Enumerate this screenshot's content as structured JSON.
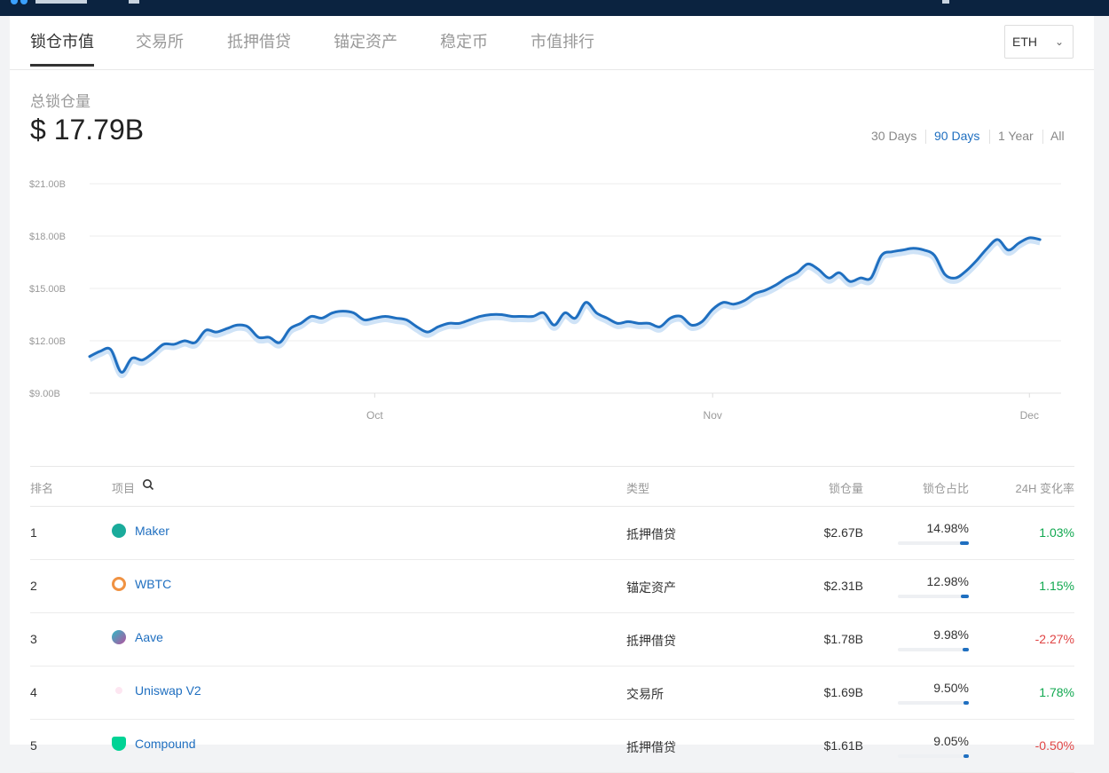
{
  "tabs": [
    {
      "label": "锁仓市值",
      "active": true
    },
    {
      "label": "交易所",
      "active": false
    },
    {
      "label": "抵押借贷",
      "active": false
    },
    {
      "label": "锚定资产",
      "active": false
    },
    {
      "label": "稳定币",
      "active": false
    },
    {
      "label": "市值排行",
      "active": false
    }
  ],
  "currency_select": {
    "value": "ETH"
  },
  "summary": {
    "label": "总锁仓量",
    "value": "$ 17.79B"
  },
  "ranges": [
    {
      "label": "30 Days",
      "active": false
    },
    {
      "label": "90 Days",
      "active": true
    },
    {
      "label": "1 Year",
      "active": false
    },
    {
      "label": "All",
      "active": false
    }
  ],
  "chart_data": {
    "type": "line",
    "yticks": [
      "$21.00B",
      "$18.00B",
      "$15.00B",
      "$12.00B",
      "$9.00B"
    ],
    "ylim": [
      9,
      21
    ],
    "xticks": [
      {
        "label": "Oct",
        "day": 27
      },
      {
        "label": "Nov",
        "day": 59
      },
      {
        "label": "Dec",
        "day": 89
      }
    ],
    "xlim": [
      0,
      92
    ],
    "grid": true,
    "color": "#1f6fc0",
    "series": [
      {
        "values": [
          11.1,
          11.4,
          11.5,
          10.2,
          11.0,
          10.9,
          11.3,
          11.8,
          11.8,
          12.0,
          11.9,
          12.6,
          12.5,
          12.7,
          12.9,
          12.8,
          12.2,
          12.2,
          11.9,
          12.7,
          13.0,
          13.4,
          13.3,
          13.6,
          13.7,
          13.6,
          13.2,
          13.3,
          13.4,
          13.3,
          13.2,
          12.8,
          12.5,
          12.8,
          13.0,
          13.0,
          13.2,
          13.4,
          13.5,
          13.5,
          13.4,
          13.4,
          13.4,
          13.6,
          12.9,
          13.6,
          13.3,
          14.2,
          13.6,
          13.3,
          13.0,
          13.1,
          13.0,
          13.0,
          12.8,
          13.3,
          13.4,
          12.9,
          13.1,
          13.8,
          14.2,
          14.1,
          14.3,
          14.7,
          14.9,
          15.2,
          15.6,
          15.9,
          16.4,
          16.1,
          15.6,
          15.9,
          15.4,
          15.6,
          15.6,
          16.9,
          17.1,
          17.2,
          17.3,
          17.2,
          16.9,
          15.8,
          15.6,
          16.0,
          16.6,
          17.3,
          17.8,
          17.2,
          17.6,
          17.9,
          17.8
        ]
      }
    ]
  },
  "table": {
    "headers": {
      "rank": "排名",
      "project": "项目",
      "type": "类型",
      "tvl": "锁仓量",
      "share": "锁仓占比",
      "change": "24H 变化率"
    },
    "rows": [
      {
        "rank": "1",
        "name": "Maker",
        "type": "抵押借贷",
        "tvl": "$2.67B",
        "share": "14.98%",
        "share_pct": 14.98,
        "change": "1.03%",
        "dir": "pos",
        "icon": "maker-icon",
        "icon_color": "#1aab9b"
      },
      {
        "rank": "2",
        "name": "WBTC",
        "type": "锚定资产",
        "tvl": "$2.31B",
        "share": "12.98%",
        "share_pct": 12.98,
        "change": "1.15%",
        "dir": "pos",
        "icon": "wbtc-icon",
        "icon_color": "#f09242"
      },
      {
        "rank": "3",
        "name": "Aave",
        "type": "抵押借贷",
        "tvl": "$1.78B",
        "share": "9.98%",
        "share_pct": 9.98,
        "change": "-2.27%",
        "dir": "neg",
        "icon": "aave-icon",
        "icon_color": "#2ebac6"
      },
      {
        "rank": "4",
        "name": "Uniswap V2",
        "type": "交易所",
        "tvl": "$1.69B",
        "share": "9.50%",
        "share_pct": 9.5,
        "change": "1.78%",
        "dir": "pos",
        "icon": "uniswap-icon",
        "icon_color": "#ff007a"
      },
      {
        "rank": "5",
        "name": "Compound",
        "type": "抵押借贷",
        "tvl": "$1.61B",
        "share": "9.05%",
        "share_pct": 9.05,
        "change": "-0.50%",
        "dir": "neg",
        "icon": "compound-icon",
        "icon_color": "#00d395"
      }
    ]
  }
}
